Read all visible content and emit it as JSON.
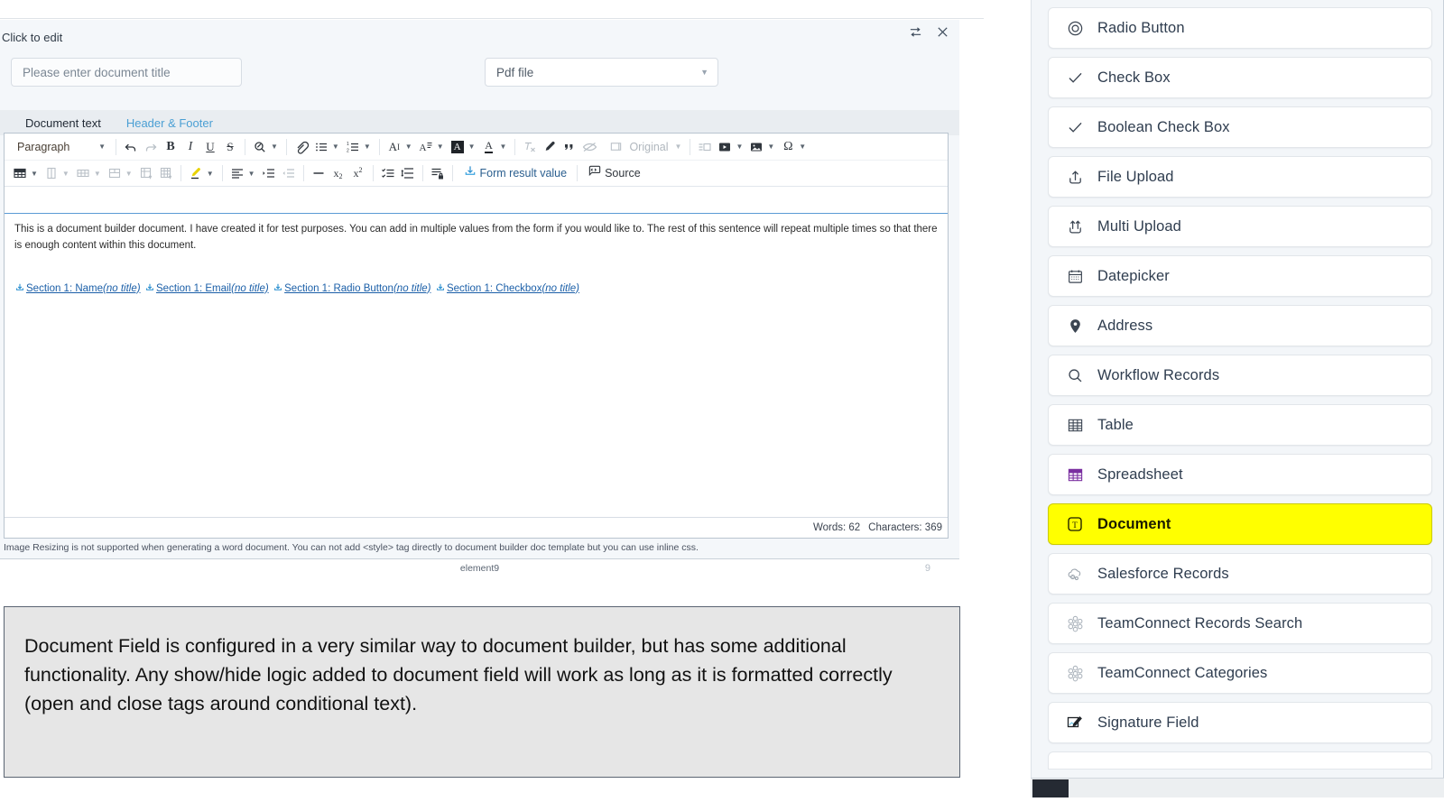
{
  "dialog": {
    "click_to_edit": "Click to edit",
    "controls": [
      {
        "name": "swap-icon",
        "title": "Swap"
      },
      {
        "name": "close-icon",
        "title": "Close"
      }
    ],
    "title_input": {
      "placeholder": "Please enter document title",
      "value": ""
    },
    "file_type_select": {
      "value": "Pdf file"
    },
    "tabs": [
      {
        "label": "Document text",
        "active": true
      },
      {
        "label": "Header & Footer",
        "active": false
      }
    ]
  },
  "toolbar": {
    "paragraph_dropdown": "Paragraph",
    "original_label": "Original",
    "form_result_value_label": "Form result value",
    "source_label": "Source",
    "row1": [
      {
        "name": "undo-icon"
      },
      {
        "name": "redo-icon"
      },
      {
        "name": "bold-icon"
      },
      {
        "name": "italic-icon"
      },
      {
        "name": "underline-icon"
      },
      {
        "name": "strikethrough-icon"
      },
      {
        "name": "find-replace-icon"
      },
      {
        "name": "link-icon"
      },
      {
        "name": "bulleted-list-icon"
      },
      {
        "name": "numbered-list-icon"
      },
      {
        "name": "font-size-icon"
      },
      {
        "name": "line-height-icon"
      },
      {
        "name": "font-background-color-icon"
      },
      {
        "name": "font-color-icon"
      },
      {
        "name": "remove-format-icon"
      },
      {
        "name": "highlight-pen-icon"
      },
      {
        "name": "block-quote-icon"
      },
      {
        "name": "hidden-text-icon"
      },
      {
        "name": "image-resize-original-icon"
      },
      {
        "name": "page-break-icon"
      },
      {
        "name": "media-embed-icon"
      },
      {
        "name": "insert-image-icon"
      },
      {
        "name": "special-character-icon"
      }
    ],
    "row2": [
      {
        "name": "insert-table-icon"
      },
      {
        "name": "table-column-icon"
      },
      {
        "name": "table-row-icon"
      },
      {
        "name": "merge-cells-icon"
      },
      {
        "name": "table-properties-icon"
      },
      {
        "name": "table-cell-properties-icon"
      },
      {
        "name": "highlighter-icon"
      },
      {
        "name": "text-align-icon"
      },
      {
        "name": "increase-indent-icon"
      },
      {
        "name": "decrease-indent-icon"
      },
      {
        "name": "horizontal-line-icon"
      },
      {
        "name": "subscript-icon"
      },
      {
        "name": "superscript-icon"
      },
      {
        "name": "todo-list-icon"
      },
      {
        "name": "line-spacing-icon"
      },
      {
        "name": "restricted-editing-icon"
      }
    ]
  },
  "document": {
    "paragraph": "This is a document builder document. I have created it for test purposes. You can add in multiple values from the form if you would like to. The rest of this sentence will repeat multiple times so that there is enough content within this document.",
    "tokens": [
      {
        "label": "Section 1: Name",
        "suffix": "(no title)"
      },
      {
        "label": "Section 1: Email",
        "suffix": "(no title)"
      },
      {
        "label": "Section 1: Radio Button",
        "suffix": "(no title)"
      },
      {
        "label": "Section 1: Checkbox",
        "suffix": "(no title)"
      }
    ],
    "status": {
      "words": "Words: 62",
      "characters": "Characters: 369"
    },
    "note": "Image Resizing is not supported when generating a word document. You can not add <style> tag directly to document builder doc template but you can use inline css.",
    "element_label": "element9",
    "element_number": "9"
  },
  "annotation": {
    "text": "Document Field is configured in a very similar way to document builder, but has some additional functionality. Any show/hide logic added to document field will work as long as it is formatted correctly (open and close tags around conditional text)."
  },
  "right_panel": {
    "items": [
      {
        "label": "Radio Button",
        "icon": "radio-button-icon",
        "highlighted": false
      },
      {
        "label": "Check Box",
        "icon": "check-icon",
        "highlighted": false
      },
      {
        "label": "Boolean Check Box",
        "icon": "check-icon",
        "highlighted": false
      },
      {
        "label": "File Upload",
        "icon": "file-upload-icon",
        "highlighted": false
      },
      {
        "label": "Multi Upload",
        "icon": "multi-upload-icon",
        "highlighted": false
      },
      {
        "label": "Datepicker",
        "icon": "calendar-icon",
        "highlighted": false
      },
      {
        "label": "Address",
        "icon": "map-pin-icon",
        "highlighted": false
      },
      {
        "label": "Workflow Records",
        "icon": "search-icon",
        "highlighted": false
      },
      {
        "label": "Table",
        "icon": "table-icon",
        "highlighted": false
      },
      {
        "label": "Spreadsheet",
        "icon": "spreadsheet-icon",
        "highlighted": false
      },
      {
        "label": "Document",
        "icon": "document-text-icon",
        "highlighted": true
      },
      {
        "label": "Salesforce Records",
        "icon": "salesforce-cloud-icon",
        "highlighted": false
      },
      {
        "label": "TeamConnect Records Search",
        "icon": "teamconnect-icon",
        "highlighted": false
      },
      {
        "label": "TeamConnect Categories",
        "icon": "teamconnect-icon",
        "highlighted": false
      },
      {
        "label": "Signature Field",
        "icon": "signature-icon",
        "highlighted": false
      }
    ]
  },
  "colors": {
    "accent_blue": "#1e7fc4",
    "link_blue": "#1b5fa8",
    "highlight_yellow": "#ffff00",
    "panel_bg": "#f3f6f9",
    "dialog_bg": "#f4f7fa",
    "annotation_bg": "#e6e6e6"
  }
}
